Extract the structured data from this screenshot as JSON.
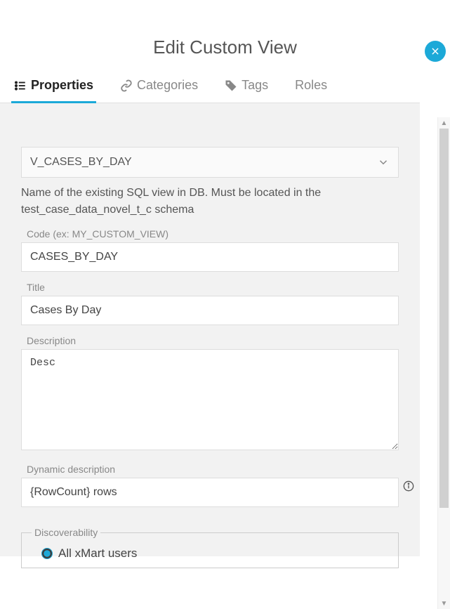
{
  "dialog": {
    "title": "Edit Custom View"
  },
  "tabs": {
    "properties": "Properties",
    "categories": "Categories",
    "tags": "Tags",
    "roles": "Roles"
  },
  "form": {
    "sql_view_select": {
      "value": "V_CASES_BY_DAY"
    },
    "sql_view_help": "Name of the existing SQL view in DB. Must be located in the test_case_data_novel_t_c schema",
    "code": {
      "label": "Code (ex: MY_CUSTOM_VIEW)",
      "value": "CASES_BY_DAY"
    },
    "title_field": {
      "label": "Title",
      "value": "Cases By Day"
    },
    "description": {
      "label": "Description",
      "value": "Desc"
    },
    "dynamic_description": {
      "label": "Dynamic description",
      "value": "{RowCount} rows"
    },
    "discoverability": {
      "legend": "Discoverability",
      "option_all": "All xMart users"
    }
  }
}
